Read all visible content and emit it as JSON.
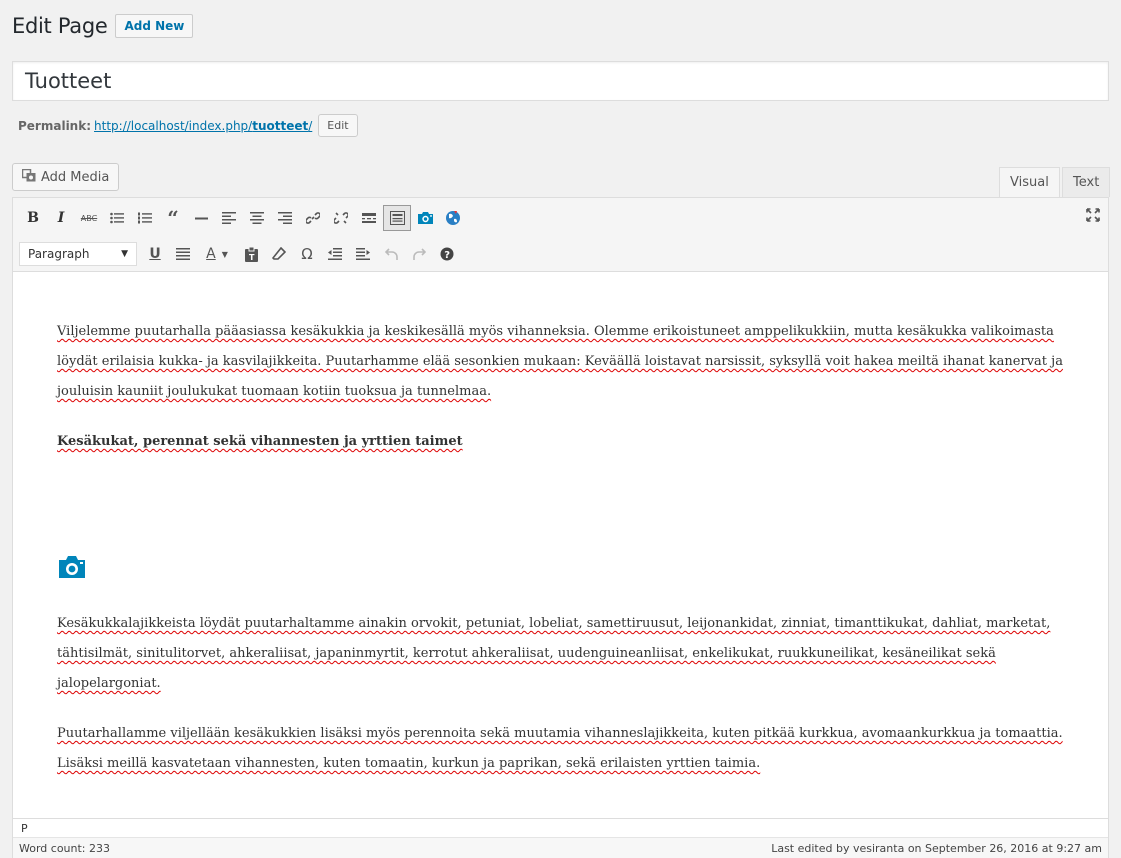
{
  "header": {
    "title": "Edit Page",
    "add_new": "Add New"
  },
  "title_field": {
    "value": "Tuotteet"
  },
  "permalink": {
    "label": "Permalink:",
    "url_base": "http://localhost/index.php/",
    "slug": "tuotteet",
    "trailing": "/",
    "edit_label": "Edit"
  },
  "media": {
    "add_media_label": "Add Media"
  },
  "tabs": {
    "visual": "Visual",
    "text": "Text"
  },
  "toolbar": {
    "format": "Paragraph",
    "row1_icons": [
      "bold-icon",
      "italic-icon",
      "strikethrough-icon",
      "bullet-list-icon",
      "numbered-list-icon",
      "blockquote-icon",
      "horizontal-rule-icon",
      "align-left-icon",
      "align-center-icon",
      "align-right-icon",
      "link-icon",
      "unlink-icon",
      "read-more-icon",
      "toolbar-toggle-icon",
      "camera-icon",
      "globe-icon"
    ],
    "row2_icons": [
      "underline-icon",
      "justify-icon",
      "text-color-icon",
      "paste-text-icon",
      "clear-formatting-icon",
      "special-character-icon",
      "outdent-icon",
      "indent-icon",
      "undo-icon",
      "redo-icon",
      "help-icon"
    ],
    "bold": "B",
    "italic": "I",
    "strike": "ABC",
    "underline": "U",
    "text_color": "A",
    "omega": "Ω"
  },
  "content": {
    "paragraph1": "Viljelemme puutarhalla pääasiassa kesäkukkia ja keskikesällä myös vihanneksia. Olemme erikoistuneet amppelikukkiin, mutta kesäkukka valikoimasta löydät erilaisia kukka- ja kasvilajikkeita. Puutarhamme elää sesonkien mukaan: Keväällä loistavat narsissit, syksyllä voit hakea meiltä ihanat kanervat ja jouluisin kauniit joulukukat tuomaan kotiin tuoksua ja tunnelmaa.",
    "heading": "Kesäkukat, perennat sekä vihannesten ja yrttien taimet",
    "paragraph2": "Kesäkukkalajikkeista löydät puutarhaltamme ainakin orvokit, petuniat, lobeliat, samettiruusut, leijonankidat, zinniat, timanttikukat, dahliat, marketat, tähtisilmät, sinitulitorvet, ahkeraliisat, japaninmyrtit, kerrotut ahkeraliisat, uudenguineanliisat, enkelikukat, ruukkuneilikat, kesäneilikat sekä jalopelargoniat.",
    "paragraph3": "Puutarhallamme viljellään kesäkukkien lisäksi myös perennoita sekä muutamia vihanneslajikkeita, kuten pitkää kurkkua, avomaankurkkua ja tomaattia. Lisäksi meillä kasvatetaan vihannesten, kuten tomaatin, kurkun ja paprikan, sekä erilaisten yrttien taimia."
  },
  "path": "P",
  "status": {
    "word_count": "Word count: 233",
    "last_edited": "Last edited by vesiranta on September 26, 2016 at 9:27 am"
  },
  "colors": {
    "accent": "#0073aa",
    "camera": "#0085ba",
    "spell_error": "#dd0000"
  }
}
